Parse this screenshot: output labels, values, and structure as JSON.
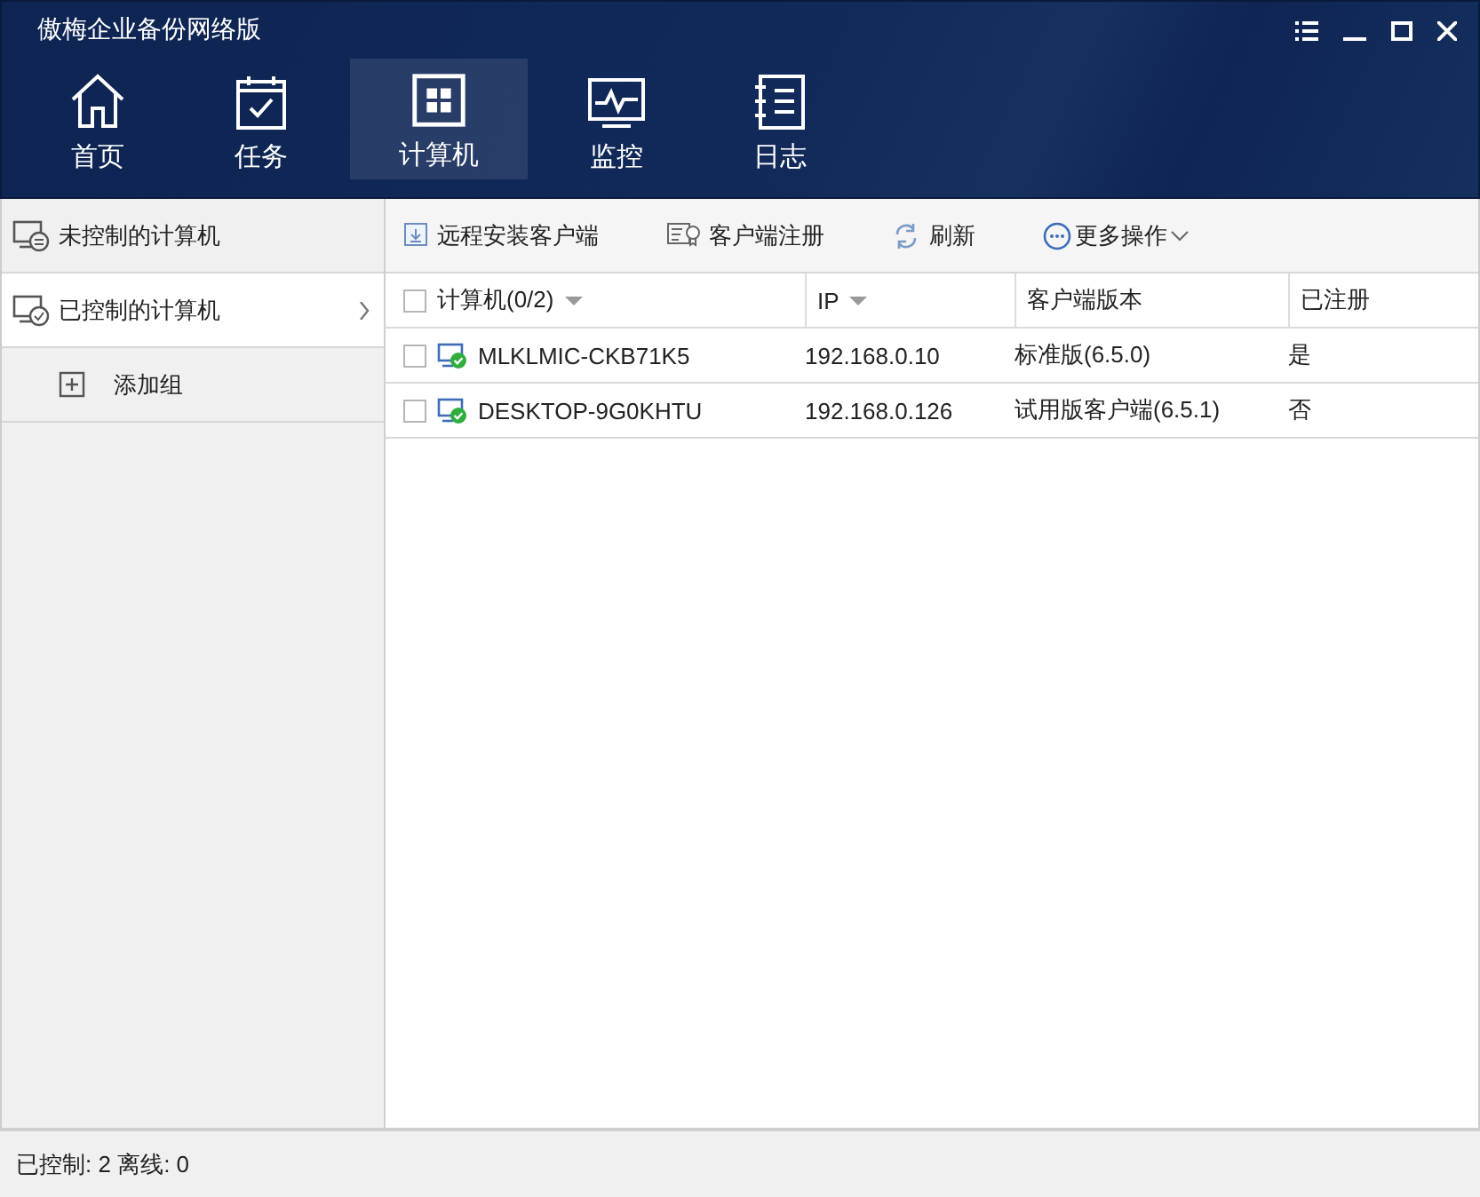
{
  "window": {
    "title": "傲梅企业备份网络版"
  },
  "nav_tabs": [
    {
      "label": "首页",
      "selected": false
    },
    {
      "label": "任务",
      "selected": false
    },
    {
      "label": "计算机",
      "selected": true
    },
    {
      "label": "监控",
      "selected": false
    },
    {
      "label": "日志",
      "selected": false
    }
  ],
  "sidebar": {
    "items": [
      {
        "label": "未控制的计算机",
        "kind": "uncontrolled",
        "selected": false,
        "has_submenu": false
      },
      {
        "label": "已控制的计算机",
        "kind": "controlled",
        "selected": true,
        "has_submenu": true
      },
      {
        "label": "添加组",
        "kind": "add",
        "selected": false,
        "has_submenu": false
      }
    ]
  },
  "toolbar": [
    {
      "label": "远程安装客户端",
      "dropdown": false
    },
    {
      "label": "客户端注册",
      "dropdown": false
    },
    {
      "label": "刷新",
      "dropdown": false
    },
    {
      "label": "更多操作",
      "dropdown": true
    }
  ],
  "table": {
    "select_all_checked": false,
    "columns": [
      {
        "label": "计算机(0/2)",
        "sortable": true
      },
      {
        "label": "IP",
        "sortable": true
      },
      {
        "label": "客户端版本",
        "sortable": false
      },
      {
        "label": "已注册",
        "sortable": false
      }
    ],
    "rows": [
      {
        "checked": false,
        "online": true,
        "cells": [
          "MLKLMIC-CKB71K5",
          "192.168.0.10",
          "标准版(6.5.0)",
          "是"
        ]
      },
      {
        "checked": false,
        "online": true,
        "cells": [
          "DESKTOP-9G0KHTU",
          "192.168.0.126",
          "试用版客户端(6.5.1)",
          "否"
        ]
      }
    ]
  },
  "status_bar": {
    "text": "已控制: 2 离线: 0"
  }
}
